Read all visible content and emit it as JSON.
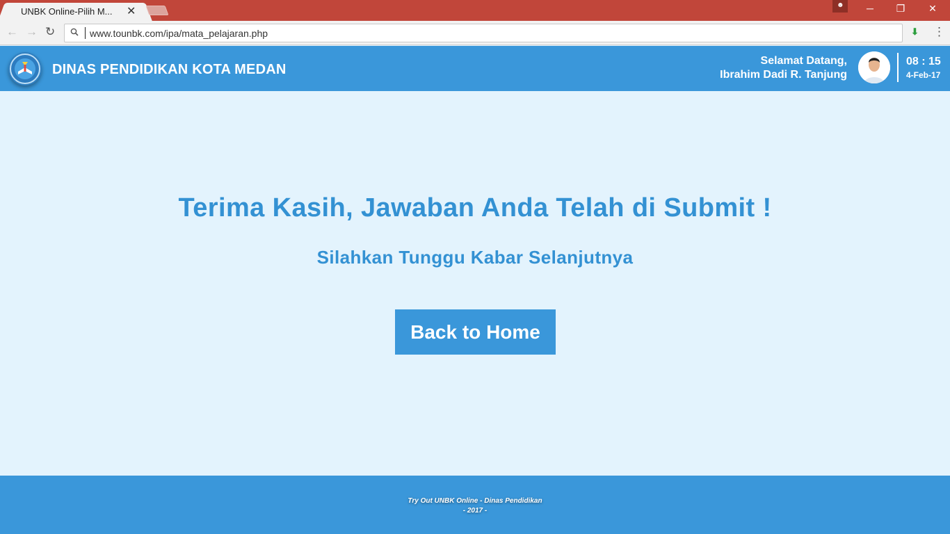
{
  "browser": {
    "tab_title": "UNBK Online-Pilih M...",
    "tab_close": "✕",
    "url": "www.tounbk.com/ipa/mata_pelajaran.php",
    "window_controls": {
      "minimize": "─",
      "restore": "❐",
      "close": "✕"
    },
    "icons": {
      "back": "arrow-left-icon",
      "forward": "arrow-right-icon",
      "reload": "reload-icon",
      "download": "download-icon",
      "menu": "kebab-menu-icon"
    }
  },
  "header": {
    "brand": "DINAS PENDIDIKAN KOTA MEDAN",
    "welcome_line1": "Selamat Datang,",
    "welcome_line2": "Ibrahim Dadi R. Tanjung",
    "time": "08 : 15",
    "date": "4-Feb-17"
  },
  "main": {
    "title": "Terima Kasih, Jawaban Anda Telah di Submit !",
    "subtitle": "Silahkan Tunggu Kabar Selanjutnya",
    "home_button": "Back to Home"
  },
  "footer": {
    "line1": "Try Out UNBK Online - Dinas Pendidikan",
    "line2": "- 2017 -"
  },
  "colors": {
    "primary": "#3a97da",
    "text_accent": "#3391d3",
    "page_bg": "#e3f3fd",
    "browser_frame": "#c1463a"
  }
}
